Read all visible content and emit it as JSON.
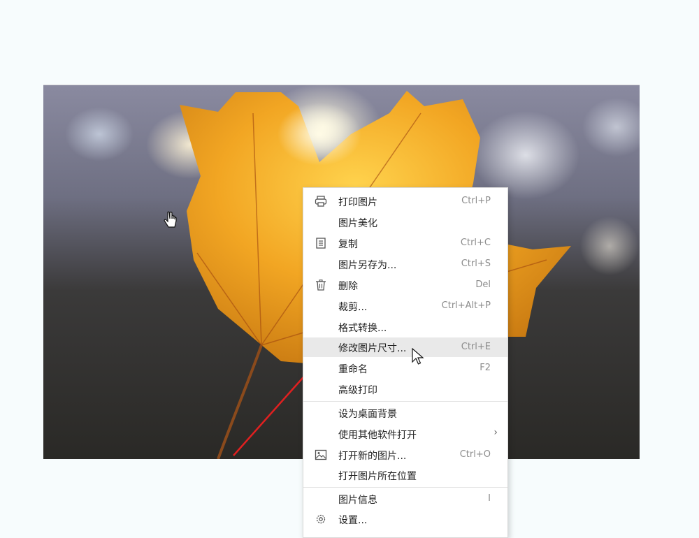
{
  "menu": {
    "items": [
      {
        "label": "打印图片",
        "shortcut": "Ctrl+P",
        "icon": "printer-icon"
      },
      {
        "label": "图片美化",
        "shortcut": ""
      },
      {
        "label": "复制",
        "shortcut": "Ctrl+C",
        "icon": "copy-icon"
      },
      {
        "label": "图片另存为...",
        "shortcut": "Ctrl+S"
      },
      {
        "label": "删除",
        "shortcut": "Del",
        "icon": "trash-icon"
      },
      {
        "label": "裁剪...",
        "shortcut": "Ctrl+Alt+P"
      },
      {
        "label": "格式转换...",
        "shortcut": ""
      },
      {
        "label": "修改图片尺寸...",
        "shortcut": "Ctrl+E",
        "highlighted": true
      },
      {
        "label": "重命名",
        "shortcut": "F2"
      },
      {
        "label": "高级打印",
        "shortcut": ""
      },
      {
        "label": "设为桌面背景",
        "shortcut": ""
      },
      {
        "label": "使用其他软件打开",
        "shortcut": "",
        "submenu": true
      },
      {
        "label": "打开新的图片...",
        "shortcut": "Ctrl+O",
        "icon": "image-icon"
      },
      {
        "label": "打开图片所在位置",
        "shortcut": ""
      },
      {
        "label": "图片信息",
        "shortcut": "I"
      },
      {
        "label": "设置...",
        "shortcut": "",
        "icon": "gear-icon"
      }
    ],
    "submenu_glyph": "›"
  },
  "annotation": {
    "arrow_color": "#e02020"
  },
  "cursor_icons": [
    "hand-pointer-icon",
    "arrow-pointer-icon"
  ]
}
